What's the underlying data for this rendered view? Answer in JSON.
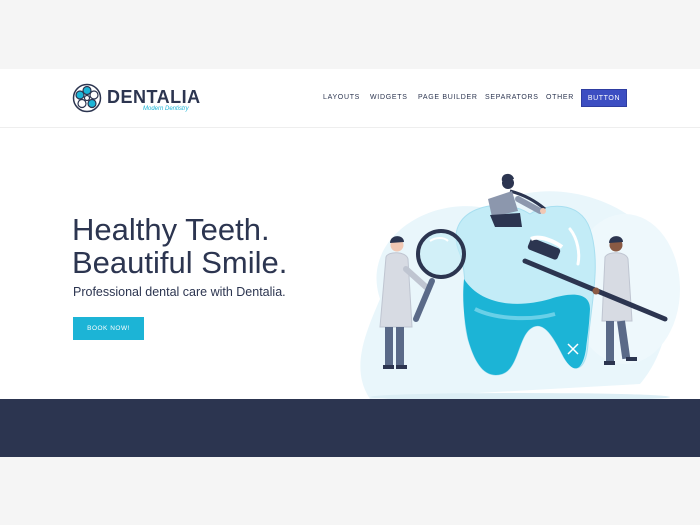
{
  "brand": {
    "name": "DENTALIA",
    "tagline": "Modern Dentistry",
    "accent": "#1cb4d6",
    "dark": "#2c3550",
    "button_color": "#3c4ec2"
  },
  "nav": {
    "items": [
      "LAYOUTS",
      "WIDGETS",
      "PAGE BUILDER",
      "SEPARATORS",
      "OTHER"
    ],
    "button_label": "BUTTON"
  },
  "hero": {
    "title_line1": "Healthy Teeth.",
    "title_line2": "Beautiful Smile.",
    "subtitle": "Professional dental care with Dentalia.",
    "cta_label": "BOOK NOW!"
  },
  "illustration": {
    "icon": "dentists-cleaning-giant-tooth-illustration"
  }
}
